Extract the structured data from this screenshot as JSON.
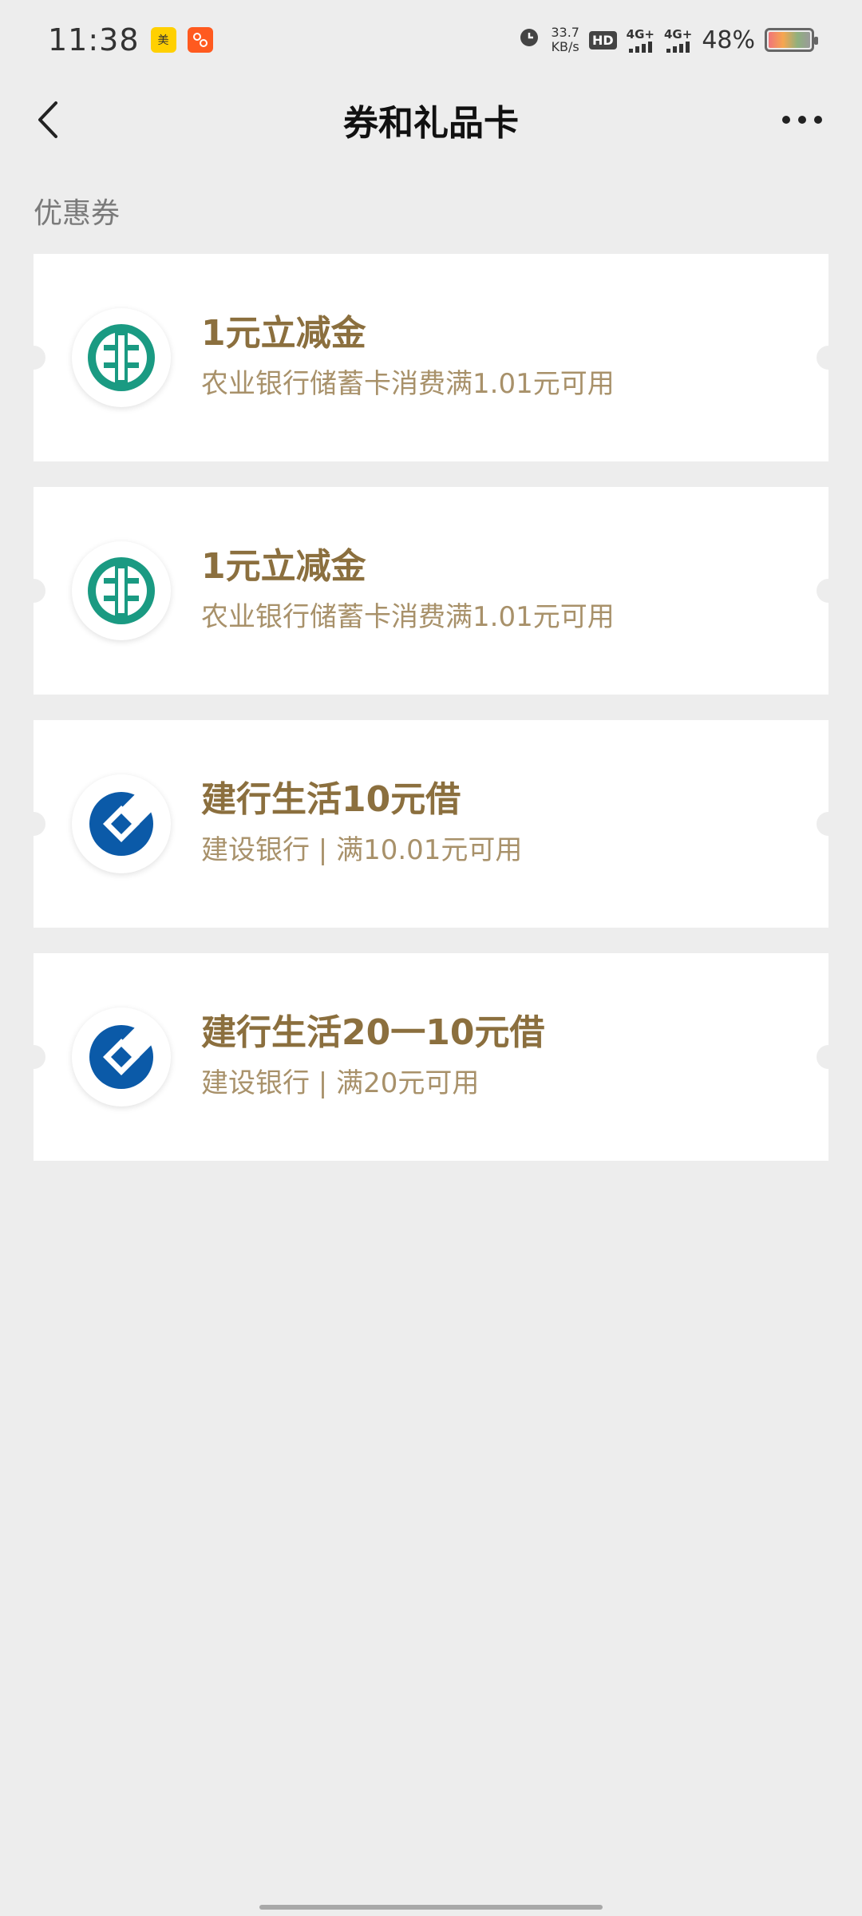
{
  "status_bar": {
    "time": "11:38",
    "app_icons": [
      "meituan-app-icon",
      "taobao-app-icon"
    ],
    "net_speed_value": "33.7",
    "net_speed_unit": "KB/s",
    "hd_label": "HD",
    "network_1": "4G+",
    "network_2": "4G+",
    "battery_percent": "48%",
    "battery_level": 0.48
  },
  "nav": {
    "title": "券和礼品卡",
    "back_icon": "chevron-left-icon",
    "more_icon": "more-dots-icon"
  },
  "section": {
    "label": "优惠券"
  },
  "coupons": [
    {
      "title": "1元立减金",
      "desc": "农业银行储蓄卡消费满1.01元可用",
      "logo": "abc-bank-logo",
      "logo_color": "#1a9a82"
    },
    {
      "title": "1元立减金",
      "desc": "农业银行储蓄卡消费满1.01元可用",
      "logo": "abc-bank-logo",
      "logo_color": "#1a9a82"
    },
    {
      "title": "建行生活10元借",
      "desc": "建设银行 | 满10.01元可用",
      "logo": "ccb-bank-logo",
      "logo_color": "#0b5aa8"
    },
    {
      "title": "建行生活20一10元借",
      "desc": "建设银行 | 满20元可用",
      "logo": "ccb-bank-logo",
      "logo_color": "#0b5aa8"
    }
  ],
  "colors": {
    "background": "#ededed",
    "coupon_title": "#8b6f3e",
    "coupon_desc": "#a8916a"
  }
}
